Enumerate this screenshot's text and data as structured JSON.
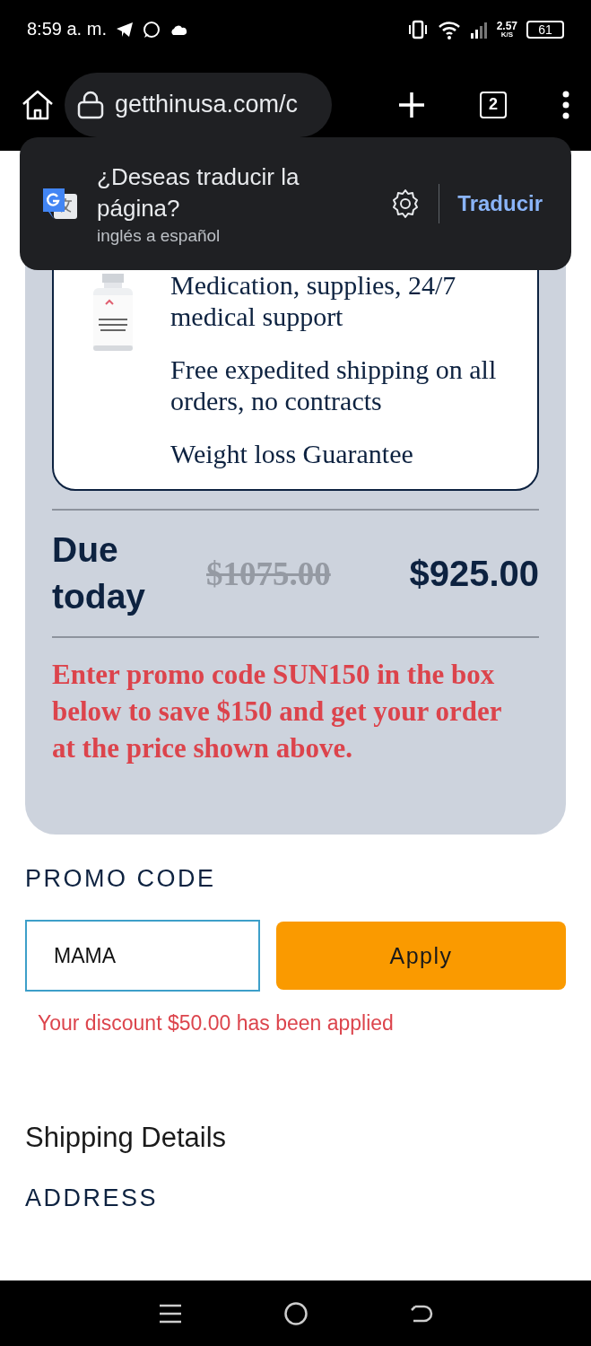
{
  "status_bar": {
    "time": "8:59 a. m.",
    "speed_value": "2.57",
    "speed_unit": "K/S",
    "battery": "61"
  },
  "browser": {
    "url": "getthinusa.com/c",
    "tab_count": "2"
  },
  "translate_popup": {
    "title": "¿Deseas traducir la página?",
    "subtitle": "inglés a español",
    "action": "Traducir"
  },
  "order_card": {
    "features": [
      "Medication, supplies, 24/7 medical support",
      "Free expedited shipping on all orders, no contracts",
      "Weight loss Guarantee"
    ]
  },
  "due": {
    "label": "Due today",
    "old_price": "$1075.00",
    "price": "$925.00"
  },
  "promo_notice": "Enter promo code SUN150 in the box below to save $150 and get your order at the price shown above.",
  "promo": {
    "heading": "PROMO CODE",
    "value": "MAMA",
    "button": "Apply",
    "message": "Your discount $50.00 has been applied"
  },
  "shipping": {
    "heading": "Shipping Details",
    "address_label": "ADDRESS"
  }
}
